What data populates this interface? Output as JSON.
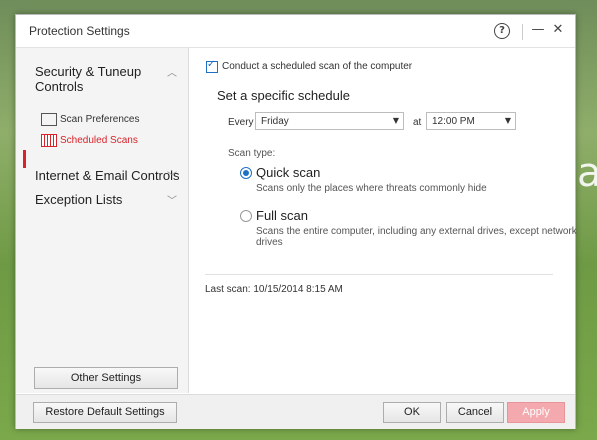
{
  "window": {
    "title": "Protection Settings"
  },
  "sidebar": {
    "sections": [
      {
        "label": "Security & Tuneup Controls",
        "label_line1": "Security & Tuneup",
        "label_line2": "Controls"
      },
      {
        "label": "Internet & Email Controls"
      },
      {
        "label": "Exception Lists"
      }
    ],
    "items": [
      {
        "label": "Scan Preferences",
        "icon": "monitor-icon"
      },
      {
        "label": "Scheduled Scans",
        "icon": "calendar-icon",
        "active": true
      }
    ],
    "other_settings": "Other Settings"
  },
  "content": {
    "scheduled_checkbox_label": "Conduct a scheduled scan of the computer",
    "schedule_heading": "Set a specific schedule",
    "every_label": "Every",
    "day_value": "Friday",
    "at_label": "at",
    "time_value": "12:00 PM",
    "scan_type_label": "Scan type:",
    "quick_scan": {
      "label": "Quick scan",
      "desc": "Scans only the places where threats commonly hide",
      "selected": true
    },
    "full_scan": {
      "label": "Full scan",
      "desc_line1": "Scans the entire computer, including any external drives, except network",
      "desc_line2": "drives",
      "selected": false
    },
    "last_scan": "Last scan: 10/15/2014 8:15 AM"
  },
  "footer": {
    "restore": "Restore Default Settings",
    "ok": "OK",
    "cancel": "Cancel",
    "apply": "Apply"
  },
  "colors": {
    "accent": "#d8232a",
    "link": "#1e6fc6",
    "apply_disabled": "#f3a9ad"
  }
}
